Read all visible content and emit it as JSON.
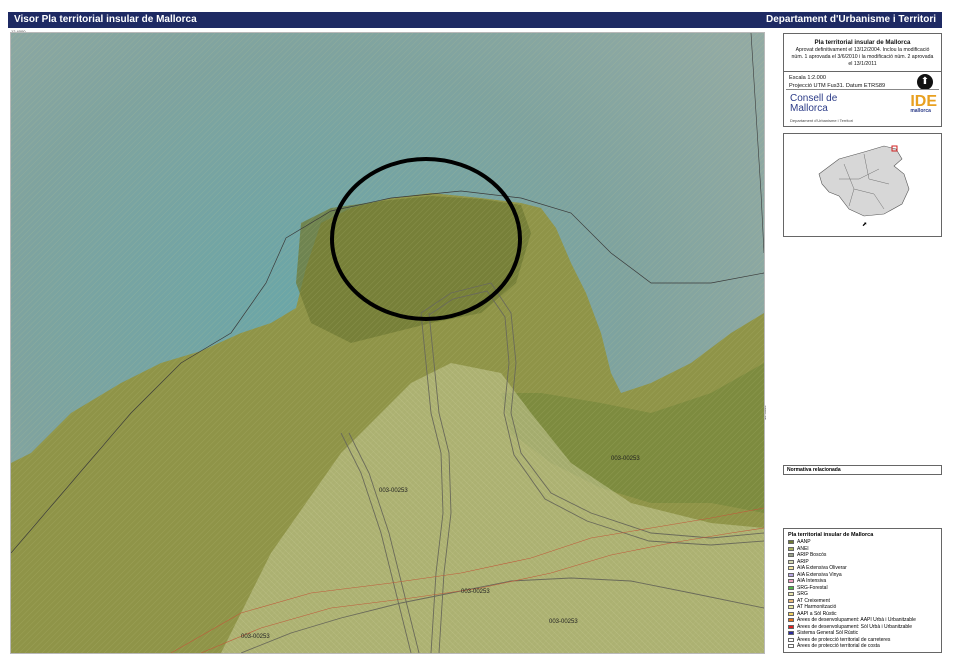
{
  "header": {
    "left_title": "Visor Pla territorial insular de Mallorca",
    "right_title": "Departament d'Urbanisme i Territori"
  },
  "map": {
    "coord_top_left": "12 4000",
    "coord_right_mid": "40 4000",
    "parcel_labels": [
      {
        "text": "003-00253"
      },
      {
        "text": "003-00253"
      },
      {
        "text": "003-00253"
      },
      {
        "text": "003-00253"
      },
      {
        "text": "003-00253"
      }
    ],
    "colors": {
      "sea": "#7fa39f",
      "land": "#8f9448",
      "land_dark": "#6f7a34",
      "category_light": "#c5c896",
      "buffer": "#c05a3a",
      "outline": "#3a3a3a",
      "highlight_circle": "#000000"
    }
  },
  "title_box": {
    "title": "Pla territorial insular de Mallorca",
    "description": "Aprovat definitivament el 13/12/2004. Inclou la modificació núm. 1 aprovada el 3/6/2010 i la modificació núm. 2 aprovada el 13/1/2011",
    "scale_text": "Escala 1:2.000",
    "projection_text": "Projecció UTM Fus31. Datum ETRS89",
    "north_icon": "north-arrow-icon",
    "logo_left_1": "Consell de",
    "logo_left_2": "Mallorca",
    "logo_left_sub": "Departament d'Urbanisme i Territori",
    "logo_right": "IDE",
    "logo_right_sub": "mallorca"
  },
  "normativa_label": "Normativa relacionada",
  "legend": {
    "title": "Pla territorial insular de Mallorca",
    "items": [
      {
        "label": "AANP",
        "color": "#6f7a34"
      },
      {
        "label": "ANEI",
        "color": "#a8b160"
      },
      {
        "label": "ARIP Boscós",
        "color": "#9aa28a"
      },
      {
        "label": "ARIP",
        "color": "#d5d9b0"
      },
      {
        "label": "AIA Extensiva Oliverar",
        "color": "#f1e6a0"
      },
      {
        "label": "AIA Extensiva Vinya",
        "color": "#b8a6e2"
      },
      {
        "label": "AIA Intensiva",
        "color": "#f2a0c0"
      },
      {
        "label": "SRG-Forestal",
        "color": "#4fb84a"
      },
      {
        "label": "SRG",
        "color": "#e8e4b0"
      },
      {
        "label": "AT Creixement",
        "color": "#e8b878"
      },
      {
        "label": "AT Harmonització",
        "color": "#e6e6a0"
      },
      {
        "label": "AAPI a Sòl Rústic",
        "color": "#f0d060"
      },
      {
        "label": "Àrees de desenvolupament: AAPI Urbà i Urbanitzable",
        "color": "#e8701a"
      },
      {
        "label": "Àrees de desenvolupament: Sòl Urbà i Urbanitzable",
        "color": "#e02020"
      },
      {
        "label": "Sistema General Sòl Rústic",
        "color": "#2a2aa0"
      },
      {
        "label": "Àrees de protecció territorial de carreteres",
        "color": "#ffffff"
      },
      {
        "label": "Àrees de protecció territorial de costa",
        "color": "#ffffff"
      }
    ]
  }
}
